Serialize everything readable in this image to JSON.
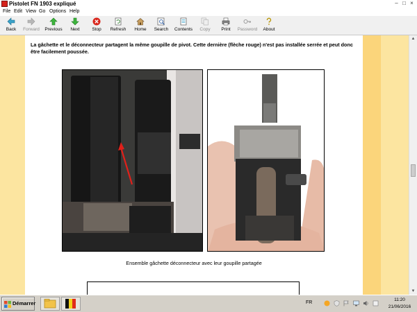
{
  "window": {
    "title": "Pistolet FN 1903 expliqué"
  },
  "menu": [
    "File",
    "Edit",
    "View",
    "Go",
    "Options",
    "Help"
  ],
  "toolbar": {
    "back": "Back",
    "forward": "Forward",
    "previous": "Previous",
    "next": "Next",
    "stop": "Stop",
    "refresh": "Refresh",
    "home": "Home",
    "search": "Search",
    "contents": "Contents",
    "copy": "Copy",
    "print": "Print",
    "password": "Password",
    "about": "About"
  },
  "content": {
    "intro": "La gâchette et le déconnecteur partagent la même goupille de pivot. Cette dernière (flèche rouge) n'est pas installée serrée et peut donc être facilement poussée.",
    "caption": "Ensemble gâchette déconnecteur avec leur goupille partagée"
  },
  "taskbar": {
    "start_label": "Démarrer",
    "language": "FR",
    "time": "11:20",
    "date": "21/06/2016"
  },
  "colors": {
    "page_background": "#fce5a0",
    "page_band": "#fbd57b",
    "arrow": "#e0201a"
  }
}
